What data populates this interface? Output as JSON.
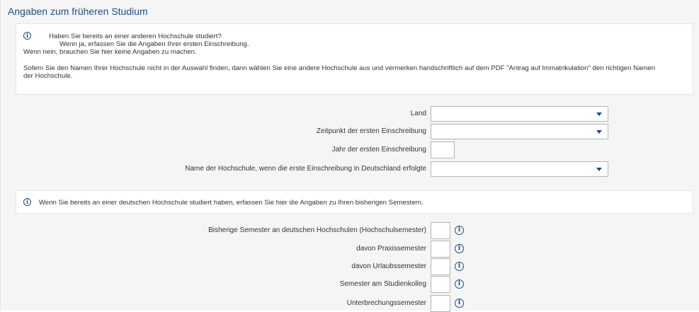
{
  "section_title": "Angaben zum früheren Studium",
  "info_box_1": {
    "lines": [
      "Haben Sie bereits an einer anderen Hochschule studiert?",
      "Wenn ja, erfassen Sie die Angaben Ihrer ersten Einschreibung.",
      "Wenn nein, brauchen Sie hier keine Angaben zu machen.",
      "Sofern Sie den Namen Ihrer Hochschule nicht in der Auswahl finden, dann wählen Sie eine andere Hochschule aus und vermerken handschriftlich auf dem PDF \"Antrag auf Immatrikulation\" den richtigen Namen",
      "der Hochschule."
    ]
  },
  "fields_1": [
    {
      "label": "Land",
      "type": "select",
      "value": ""
    },
    {
      "label": "Zeitpunkt der ersten Einschreibung",
      "type": "select",
      "value": ""
    },
    {
      "label": "Jahr der ersten Einschreibung",
      "type": "text",
      "value": ""
    },
    {
      "label": "Name der Hochschule, wenn die erste Einschreibung in Deutschland erfolgte",
      "type": "select",
      "value": ""
    }
  ],
  "info_box_2": {
    "text": "Wenn Sie bereits an einer deutschen Hochschule studiert haben, erfassen Sie hier die Angaben zu Ihren bisherigen Semestern."
  },
  "fields_2": [
    {
      "label": "Bisherige Semester an deutschen Hochschulen (Hochschulsemester)",
      "value": ""
    },
    {
      "label": "davon Praxissemester",
      "value": ""
    },
    {
      "label": "davon Urlaubssemester",
      "value": ""
    },
    {
      "label": "Semester am Studienkolleg",
      "value": ""
    },
    {
      "label": "Unterbrechungssemester",
      "value": ""
    }
  ],
  "icons": {
    "info": "info-icon",
    "help": "help-info-icon",
    "dropdown": "chevron-down-icon"
  },
  "colors": {
    "accent": "#1c4f86",
    "panel_bg": "#f5f5f5",
    "border": "#b5b5b5"
  }
}
